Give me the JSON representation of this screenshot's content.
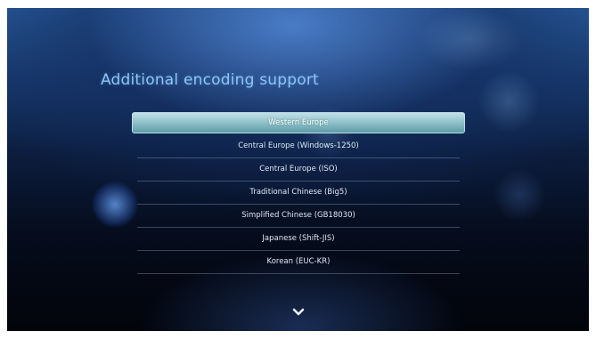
{
  "screen": {
    "title": "Additional encoding support",
    "encodings": [
      {
        "label": "Western Europe",
        "selected": true
      },
      {
        "label": "Central Europe (Windows-1250)",
        "selected": false
      },
      {
        "label": "Central Europe (ISO)",
        "selected": false
      },
      {
        "label": "Traditional Chinese (Big5)",
        "selected": false
      },
      {
        "label": "Simplified Chinese (GB18030)",
        "selected": false
      },
      {
        "label": "Japanese (Shift-JIS)",
        "selected": false
      },
      {
        "label": "Korean (EUC-KR)",
        "selected": false
      }
    ],
    "more_indicator_icon": "chevron-down-icon"
  },
  "colors": {
    "title": "#8fc6f2",
    "highlight": "#93c4cc",
    "item_text": "#dfe8f4"
  }
}
